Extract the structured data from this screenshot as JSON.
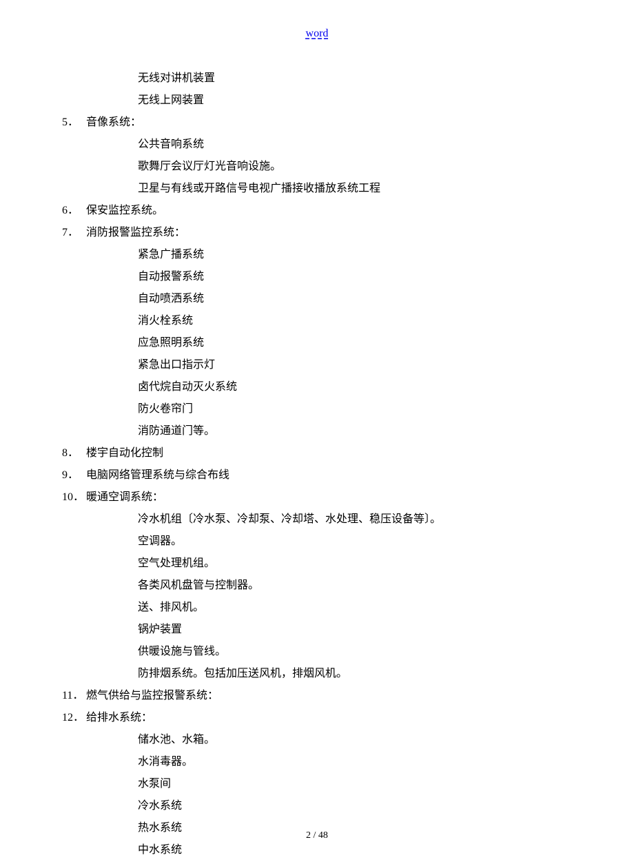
{
  "header": {
    "link_text": "word"
  },
  "pre_sub_items": [
    "无线对讲机装置",
    "无线上网装置"
  ],
  "sections": [
    {
      "num": "5．",
      "title": "音像系统：",
      "sub": [
        "公共音响系统",
        "歌舞厅会议厅灯光音响设施。",
        "卫星与有线或开路信号电视广播接收播放系统工程"
      ]
    },
    {
      "num": "6．",
      "title": "保安监控系统。",
      "sub": []
    },
    {
      "num": "7．",
      "title": "消防报警监控系统：",
      "sub": [
        "紧急广播系统",
        "自动报警系统",
        "自动喷洒系统",
        "消火栓系统",
        "应急照明系统",
        "紧急出口指示灯",
        "卤代烷自动灭火系统",
        "防火卷帘门",
        "消防通道门等。"
      ]
    },
    {
      "num": "8．",
      "title": "楼宇自动化控制",
      "sub": []
    },
    {
      "num": "9．",
      "title": "电脑网络管理系统与综合布线",
      "sub": []
    },
    {
      "num": "10．",
      "title": "暖通空调系统：",
      "sub": [
        "冷水机组〔冷水泵、冷却泵、冷却塔、水处理、稳压设备等〕。",
        "空调器。",
        "空气处理机组。",
        "各类风机盘管与控制器。",
        "送、排风机。",
        "锅炉装置",
        "供暖设施与管线。",
        "防排烟系统。包括加压送风机，排烟风机。"
      ]
    },
    {
      "num": "11．",
      "title": "燃气供给与监控报警系统：",
      "sub": []
    },
    {
      "num": "12．",
      "title": "给排水系统：",
      "sub": [
        "储水池、水箱。",
        "水消毒器。",
        "水泵间",
        "冷水系统",
        "热水系统",
        "中水系统"
      ]
    }
  ],
  "footer": {
    "page": "2 / 48"
  }
}
